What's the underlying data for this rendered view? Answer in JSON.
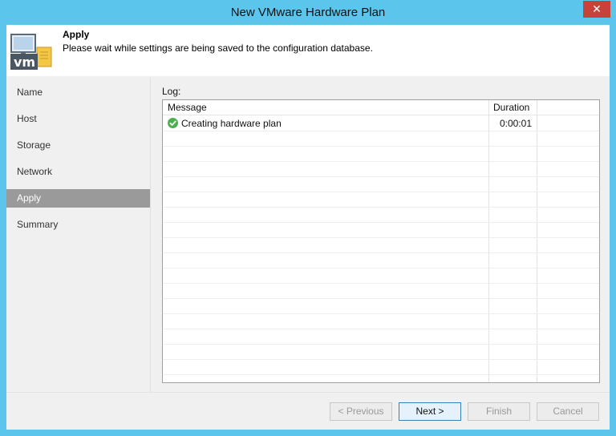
{
  "window": {
    "title": "New VMware Hardware Plan",
    "close_label": "✕"
  },
  "header": {
    "icon_text": "vm",
    "title": "Apply",
    "description": "Please wait while settings are being saved to the configuration database."
  },
  "nav": {
    "items": [
      {
        "label": "Name"
      },
      {
        "label": "Host"
      },
      {
        "label": "Storage"
      },
      {
        "label": "Network"
      },
      {
        "label": "Apply",
        "active": true
      },
      {
        "label": "Summary"
      }
    ]
  },
  "log": {
    "label": "Log:",
    "columns": [
      "Message",
      "Duration"
    ],
    "rows": [
      {
        "status": "success-icon",
        "message": "Creating hardware plan",
        "duration": "0:00:01"
      }
    ]
  },
  "buttons": {
    "previous": "< Previous",
    "next": "Next >",
    "finish": "Finish",
    "cancel": "Cancel"
  },
  "colors": {
    "titlebar": "#5bc5ec",
    "close": "#c6423a",
    "nav_active": "#9a9a9a",
    "success": "#4caf50"
  }
}
